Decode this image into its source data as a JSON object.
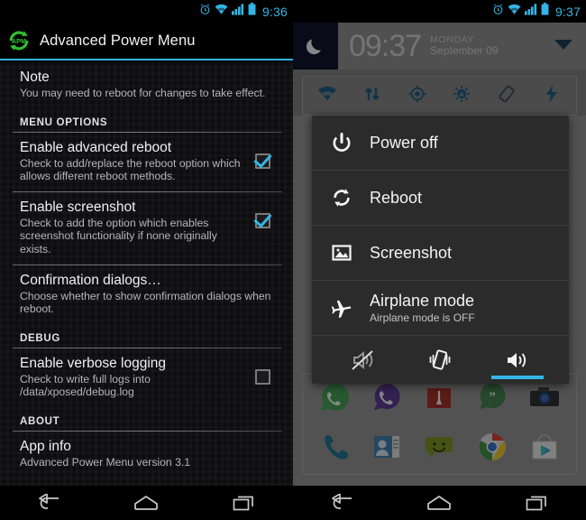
{
  "left_phone": {
    "status_bar": {
      "time": "9:36",
      "icons": [
        "alarm-icon",
        "wifi-icon",
        "signal-icon",
        "battery-icon"
      ],
      "accent_color": "#33b5e5"
    },
    "action_bar": {
      "title": "Advanced Power Menu",
      "logo": "apm-logo-icon",
      "logo_color": "#2fbf2f",
      "underline_color": "#33b5e5"
    },
    "preferences": [
      {
        "id": "note",
        "title": "Note",
        "summary": "You may need to reboot for changes to take effect.",
        "checkbox": null
      }
    ],
    "sections": [
      {
        "header": "MENU OPTIONS",
        "items": [
          {
            "id": "enable-advanced-reboot",
            "title": "Enable advanced reboot",
            "summary": "Check to add/replace the reboot option which allows different reboot methods.",
            "checked": true
          },
          {
            "id": "enable-screenshot",
            "title": "Enable screenshot",
            "summary": "Check to add the option which enables screenshot functionality if none originally exists.",
            "checked": true
          },
          {
            "id": "confirmation-dialogs",
            "title": "Confirmation dialogs…",
            "summary": "Choose whether to show confirmation dialogs when reboot.",
            "checked": null
          }
        ]
      },
      {
        "header": "DEBUG",
        "items": [
          {
            "id": "enable-verbose-logging",
            "title": "Enable verbose logging",
            "summary": "Check to write full logs into /data/xposed/debug.log",
            "checked": false
          }
        ]
      },
      {
        "header": "ABOUT",
        "items": [
          {
            "id": "app-info",
            "title": "App info",
            "summary": "Advanced Power Menu version 3.1",
            "checked": null
          }
        ]
      }
    ],
    "nav_bar": {
      "back": "back-icon",
      "home": "home-icon",
      "recents": "recents-icon"
    }
  },
  "right_phone": {
    "status_bar": {
      "time": "9:37",
      "icons": [
        "alarm-icon",
        "wifi-icon",
        "signal-icon",
        "battery-icon"
      ],
      "accent_color": "#33b5e5"
    },
    "notification_shade": {
      "clock": {
        "icon": "moon-icon",
        "time": "09:37",
        "day_of_week": "MONDAY",
        "month_day": "September 09",
        "expand": "chevron-down-icon"
      },
      "quick_settings": [
        "wifi-icon",
        "data-sync-icon",
        "location-icon",
        "auto-brightness-icon",
        "rotation-lock-icon",
        "flash-icon"
      ]
    },
    "power_dialog": {
      "items": [
        {
          "id": "power-off",
          "icon": "power-icon",
          "label": "Power off",
          "sub": null
        },
        {
          "id": "reboot",
          "icon": "reboot-icon",
          "label": "Reboot",
          "sub": null
        },
        {
          "id": "screenshot",
          "icon": "screenshot-icon",
          "label": "Screenshot",
          "sub": null
        },
        {
          "id": "airplane-mode",
          "icon": "airplane-icon",
          "label": "Airplane mode",
          "sub": "Airplane mode is OFF"
        }
      ],
      "sound_modes": [
        {
          "id": "silent",
          "icon": "mute-icon",
          "selected": false
        },
        {
          "id": "vibrate",
          "icon": "vibrate-icon",
          "selected": false
        },
        {
          "id": "sound",
          "icon": "volume-icon",
          "selected": true
        }
      ],
      "selected_indicator_color": "#33b5e5",
      "background_color": "#2b2b2b"
    },
    "home_screen": {
      "app_rows": [
        [
          "whatsapp-icon",
          "viber-icon",
          "vault-icon",
          "quotes-icon",
          "camera-icon"
        ],
        [
          "phone-icon",
          "contacts-icon",
          "messaging-icon",
          "chrome-icon",
          "play-store-icon"
        ]
      ]
    },
    "nav_bar": {
      "back": "back-icon",
      "home": "home-icon",
      "recents": "recents-icon"
    }
  }
}
